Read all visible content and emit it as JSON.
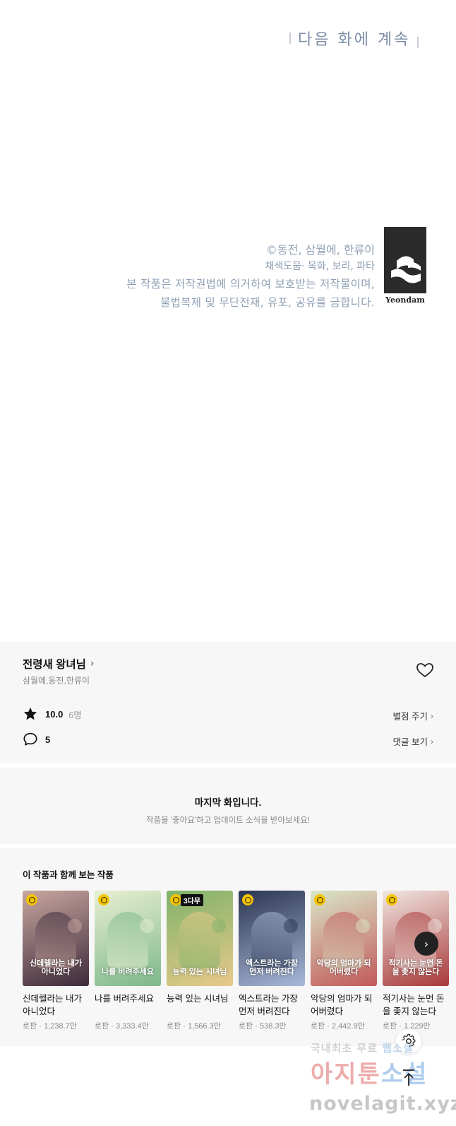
{
  "panel": {
    "next_episode": "다음 화에 계속",
    "credits": {
      "line1": "©동전, 삼월에, 한류이",
      "line2": "채색도움· 목화, 보리, 파타",
      "line3": "본 작품은 저작권법에 의거하여 보호받는 저작물이며,",
      "line4": "불법복제 및 무단전재, 유포, 공유를 금합니다."
    },
    "logo_text": "Yeondam"
  },
  "work": {
    "title": "전령새 왕녀님",
    "authors": "삼월에,동전,한류이",
    "rating": "10.0",
    "rating_count": "6명",
    "rate_link": "별점 주기",
    "comment_count": "5",
    "comment_link": "댓글 보기"
  },
  "last": {
    "heading": "마지막 화입니다.",
    "sub": "작품을 '좋아요'하고 업데이트 소식을 받아보세요!"
  },
  "recs": {
    "section_title": "이 작품과 함께 보는 작품",
    "items": [
      {
        "title": "신데렐라는 내가 아니었다",
        "meta": "로판 · 1,238.7만",
        "cover_title": "신데렐라는 내가 아니었다",
        "color1": "#c9a7a0",
        "color2": "#3d2a3a",
        "badge": ""
      },
      {
        "title": "나를 버려주세요",
        "meta": "로판 · 3,333.4만",
        "cover_title": "나를 버려주세요",
        "color1": "#e8efd2",
        "color2": "#7db88a",
        "badge": ""
      },
      {
        "title": "능력 있는 시녀님",
        "meta": "로판 · 1,566.3만",
        "cover_title": "능력 있는 시녀님",
        "color1": "#7fb36a",
        "color2": "#e8c98a",
        "badge": "3다무"
      },
      {
        "title": "엑스트라는 가장 먼저 버려진다",
        "meta": "로판 · 538.3만",
        "cover_title": "엑스트라는 가장 먼저 버려진다",
        "color1": "#2a3550",
        "color2": "#a8b8d8",
        "badge": ""
      },
      {
        "title": "악당의 엄마가 되어버렸다",
        "meta": "로판 · 2,442.9만",
        "cover_title": "악당의 엄마가 되어버렸다",
        "color1": "#d9e6c8",
        "color2": "#c25a5a",
        "badge": ""
      },
      {
        "title": "적기사는 눈먼 돈을 좇지 않는다",
        "meta": "로판 · 1,229만",
        "cover_title": "적기사는 눈먼 돈을 좇지 않는다",
        "color1": "#f0e6e0",
        "color2": "#a83a3a",
        "badge": ""
      }
    ]
  },
  "watermark": {
    "line1_a": "국내최초 무료",
    "line1_b": "웹소설",
    "line2_a": "아지툰",
    "line2_b": "소설",
    "line3": "novelagit.xyz"
  },
  "icons": {
    "heart": "heart-outline-icon",
    "star": "star-filled-icon",
    "comment": "comment-bubble-icon",
    "gear": "gear-icon",
    "scroll_top": "arrow-up-icon",
    "next": "chevron-right-icon"
  }
}
